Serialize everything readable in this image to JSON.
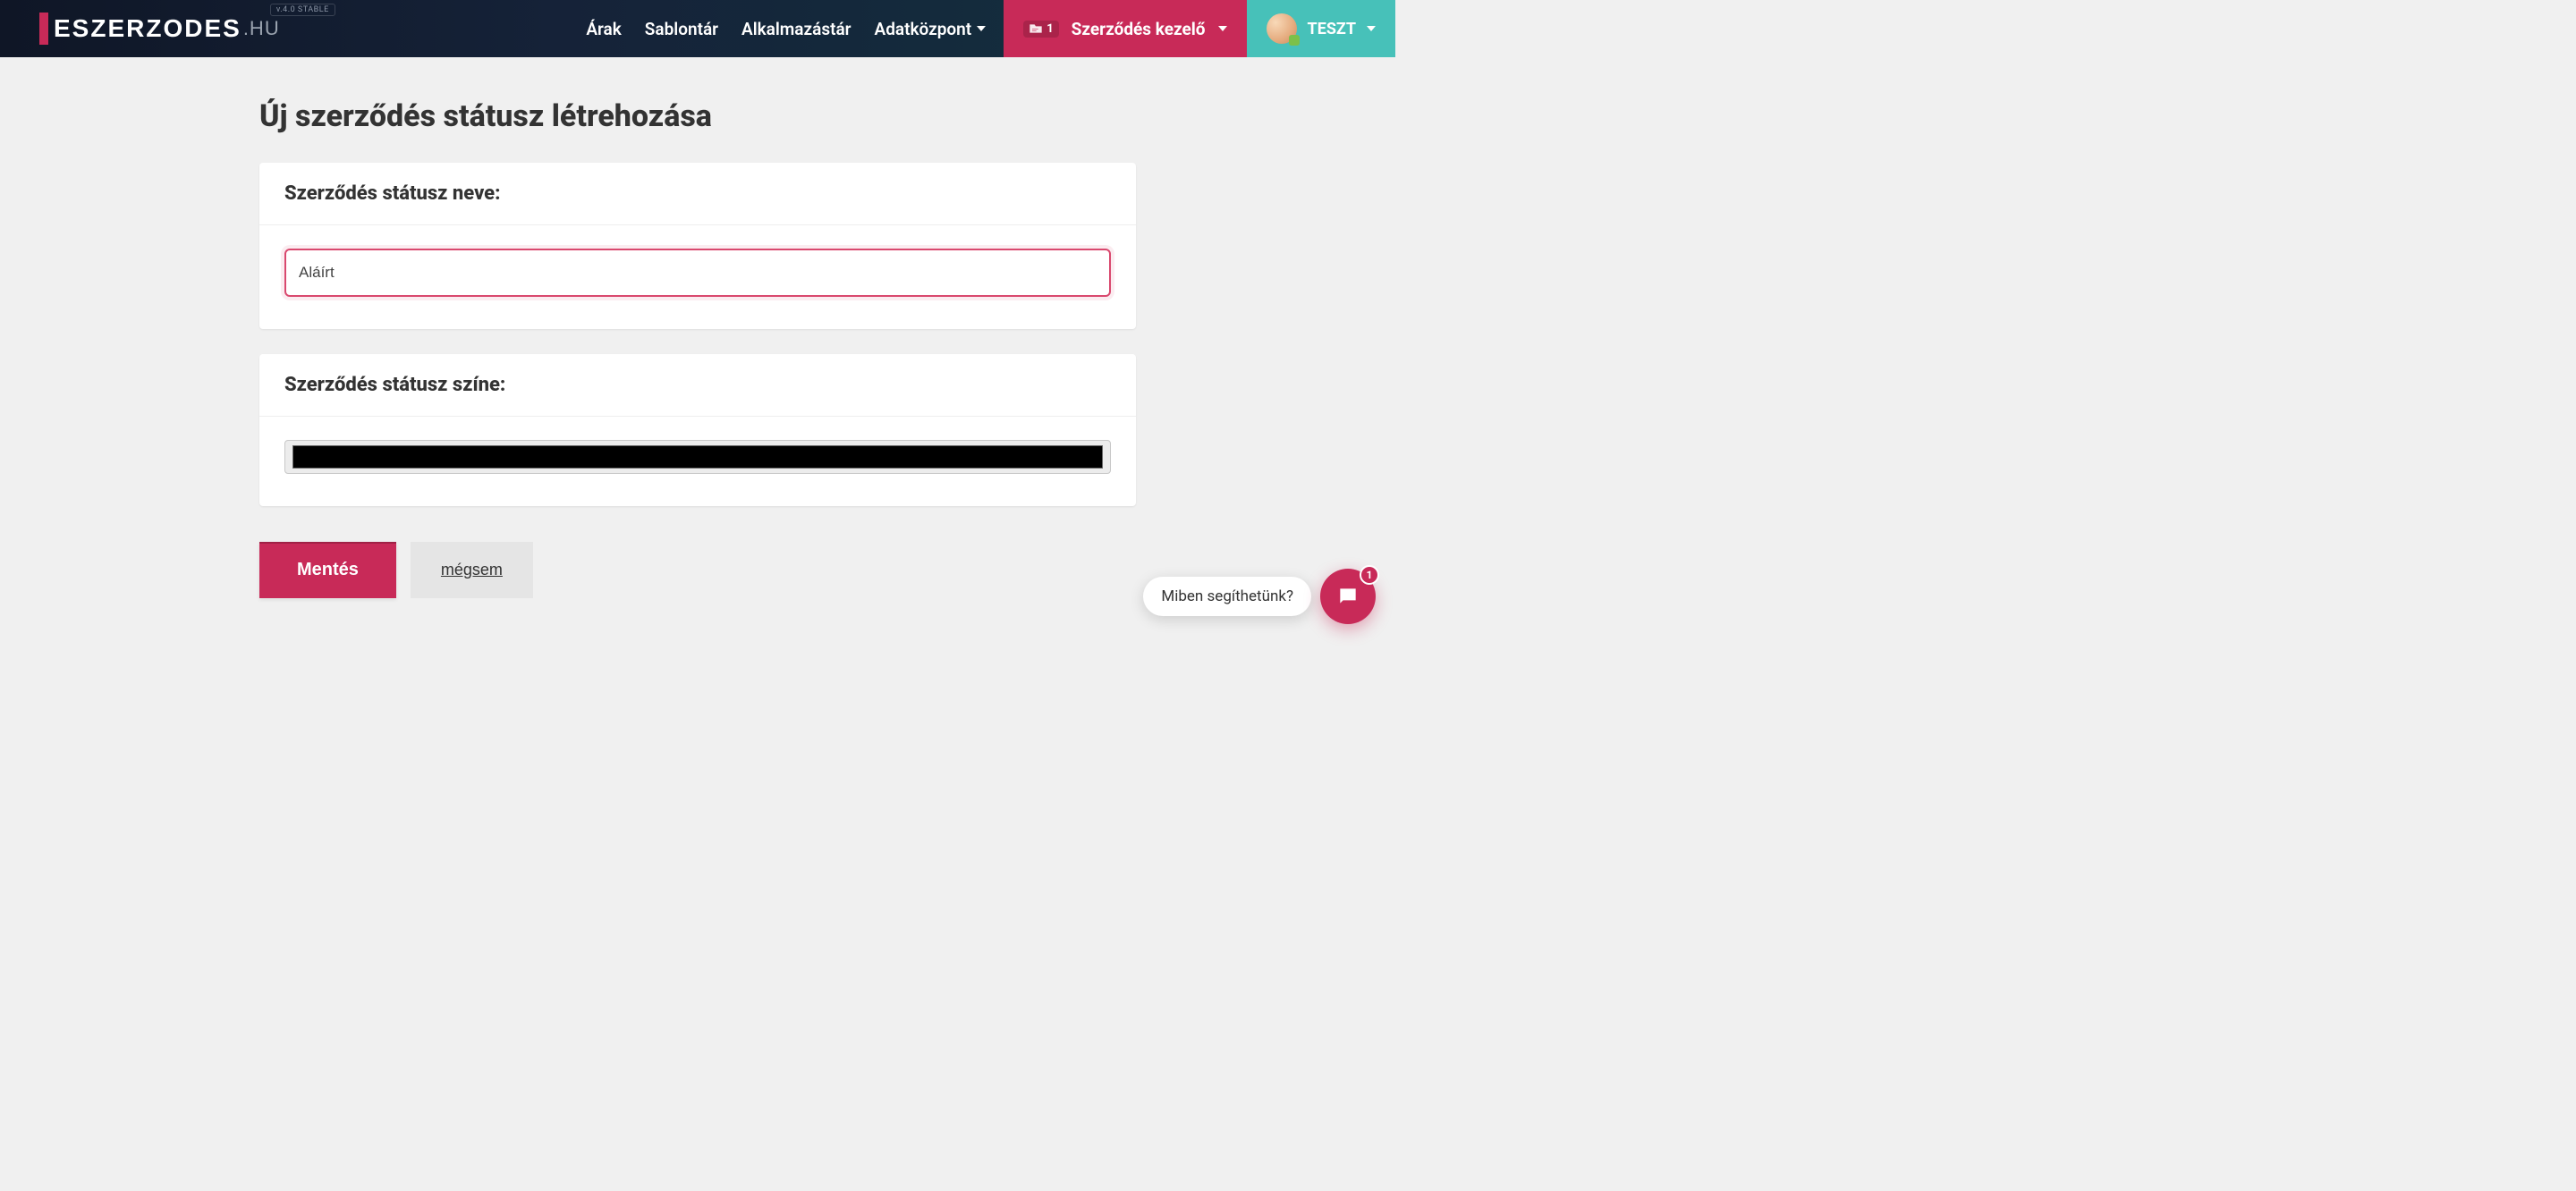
{
  "brand": {
    "main": "ESZERZODES",
    "sub": ".HU",
    "version": "v.4.0 STABLE"
  },
  "nav": {
    "arak": "Árak",
    "sablontar": "Sablontár",
    "alkalmazastar": "Alkalmazástár",
    "adatkozpont": "Adatközpont"
  },
  "contract_manager": {
    "label": "Szerződés kezelő",
    "badge_count": "1"
  },
  "user": {
    "name": "TESZT"
  },
  "page": {
    "title": "Új szerződés státusz létrehozása"
  },
  "form": {
    "name_label": "Szerződés státusz neve:",
    "name_value": "Aláírt",
    "color_label": "Szerződés státusz színe:",
    "color_value": "#000000"
  },
  "actions": {
    "save": "Mentés",
    "cancel": "mégsem"
  },
  "chat": {
    "prompt": "Miben segíthetünk?",
    "badge": "1"
  }
}
